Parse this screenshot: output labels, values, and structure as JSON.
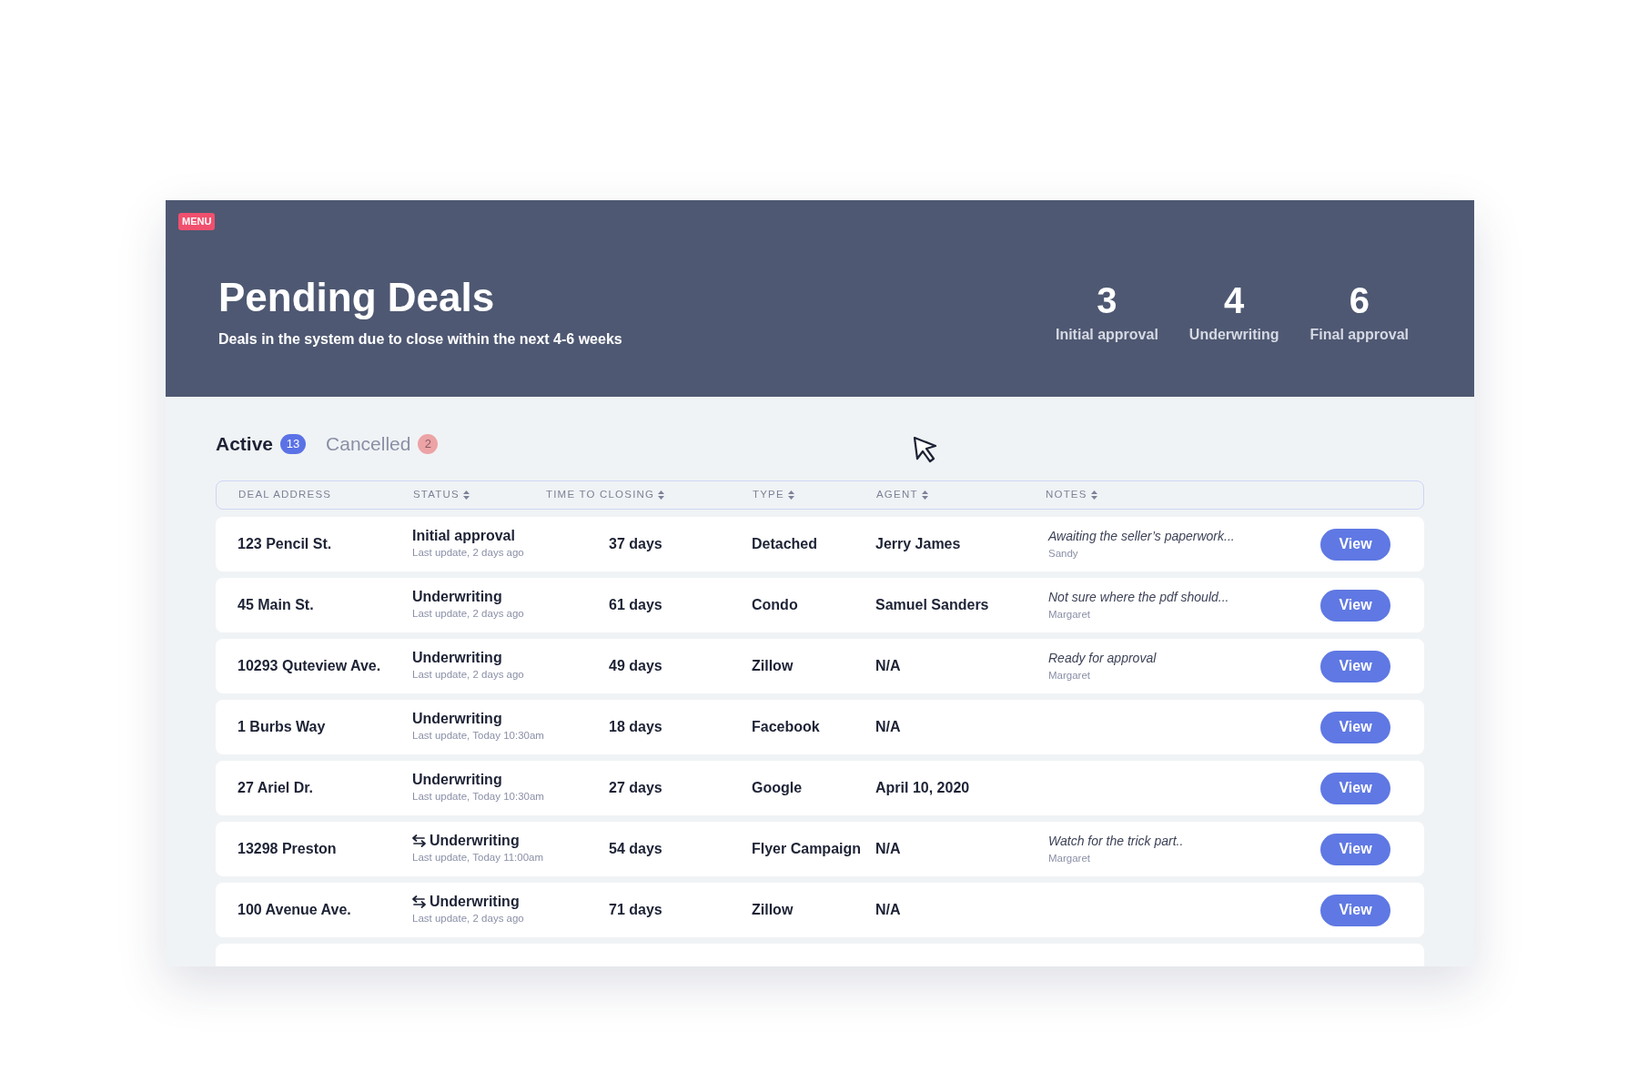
{
  "header": {
    "menu_label": "MENU",
    "title": "Pending Deals",
    "subtitle": "Deals in the system due to close within the next 4-6 weeks",
    "stats": [
      {
        "value": "3",
        "label": "Initial approval"
      },
      {
        "value": "4",
        "label": "Underwriting"
      },
      {
        "value": "6",
        "label": "Final approval"
      }
    ]
  },
  "tabs": [
    {
      "label": "Active",
      "count": "13",
      "selected": true
    },
    {
      "label": "Cancelled",
      "count": "2",
      "selected": false
    }
  ],
  "table": {
    "columns": [
      {
        "label": "DEAL ADDRESS",
        "sortable": false
      },
      {
        "label": "STATUS",
        "sortable": true
      },
      {
        "label": "TIME TO CLOSING",
        "sortable": true
      },
      {
        "label": "TYPE",
        "sortable": true
      },
      {
        "label": "AGENT",
        "sortable": true
      },
      {
        "label": "NOTES",
        "sortable": true
      }
    ],
    "rows": [
      {
        "address": "123 Pencil St.",
        "status": "Initial approval",
        "transfer": false,
        "update": "Last update, 2 days ago",
        "closing": "37 days",
        "type": "Detached",
        "agent": "Jerry James",
        "note": "Awaiting the seller’s paperwork...",
        "note_author": "Sandy",
        "action": "View"
      },
      {
        "address": "45 Main St.",
        "status": "Underwriting",
        "transfer": false,
        "update": "Last update, 2 days ago",
        "closing": "61 days",
        "type": "Condo",
        "agent": "Samuel Sanders",
        "note": "Not sure where the pdf should...",
        "note_author": "Margaret",
        "action": "View"
      },
      {
        "address": "10293 Quteview Ave.",
        "status": "Underwriting",
        "transfer": false,
        "update": "Last update, 2 days ago",
        "closing": "49 days",
        "type": "Zillow",
        "agent": "N/A",
        "note": "Ready for approval",
        "note_author": "Margaret",
        "action": "View"
      },
      {
        "address": "1 Burbs Way",
        "status": "Underwriting",
        "transfer": false,
        "update": "Last update, Today 10:30am",
        "closing": "18 days",
        "type": "Facebook",
        "agent": "N/A",
        "action": "View"
      },
      {
        "address": "27 Ariel Dr.",
        "status": "Underwriting",
        "transfer": false,
        "update": "Last update, Today 10:30am",
        "closing": "27 days",
        "type": "Google",
        "agent": "April 10, 2020",
        "action": "View"
      },
      {
        "address": "13298 Preston",
        "status": "Underwriting",
        "transfer": true,
        "update": "Last update, Today 11:00am",
        "closing": "54 days",
        "type": "Flyer Campaign",
        "agent": "N/A",
        "note": "Watch for the trick part..",
        "note_author": "Margaret",
        "action": "View"
      },
      {
        "address": "100 Avenue Ave.",
        "status": "Underwriting",
        "transfer": true,
        "update": "Last update, 2 days ago",
        "closing": "71 days",
        "type": "Zillow",
        "agent": "N/A",
        "action": "View"
      }
    ]
  }
}
